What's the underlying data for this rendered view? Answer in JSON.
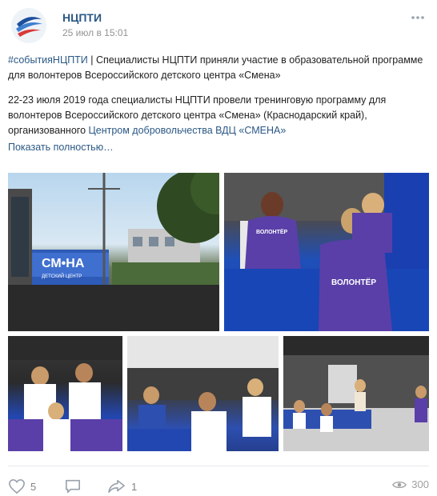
{
  "post": {
    "author": "НЦПТИ",
    "date": "25 июл в 15:01",
    "hashtag": "#событияНЦПТИ",
    "line1_rest": " | Специалисты НЦПТИ приняли участие в образовательной программе для волонтеров Всероссийского детского центра «Смена»",
    "para2_text": "22-23 июля 2019 года специалисты НЦПТИ провели тренинговую программу для волонтеров Всероссийского детского центра «Смена» (Краснодарский край), организованного ",
    "para2_link": "Центром добровольчества ВДЦ «СМЕНА»",
    "show_more": "Показать полностью…"
  },
  "photos": {
    "p1_sign": "СМ•НА",
    "p1_sub": "ДЕТСКИЙ ЦЕНТР",
    "shirt_text": "ВОЛОНТЁР"
  },
  "footer": {
    "likes": "5",
    "comments": "",
    "shares": "1",
    "views": "300"
  },
  "colors": {
    "link": "#2a5885",
    "muted": "#939393",
    "accent_blue": "#1f4fb8",
    "shirt": "#5a3fa8"
  }
}
